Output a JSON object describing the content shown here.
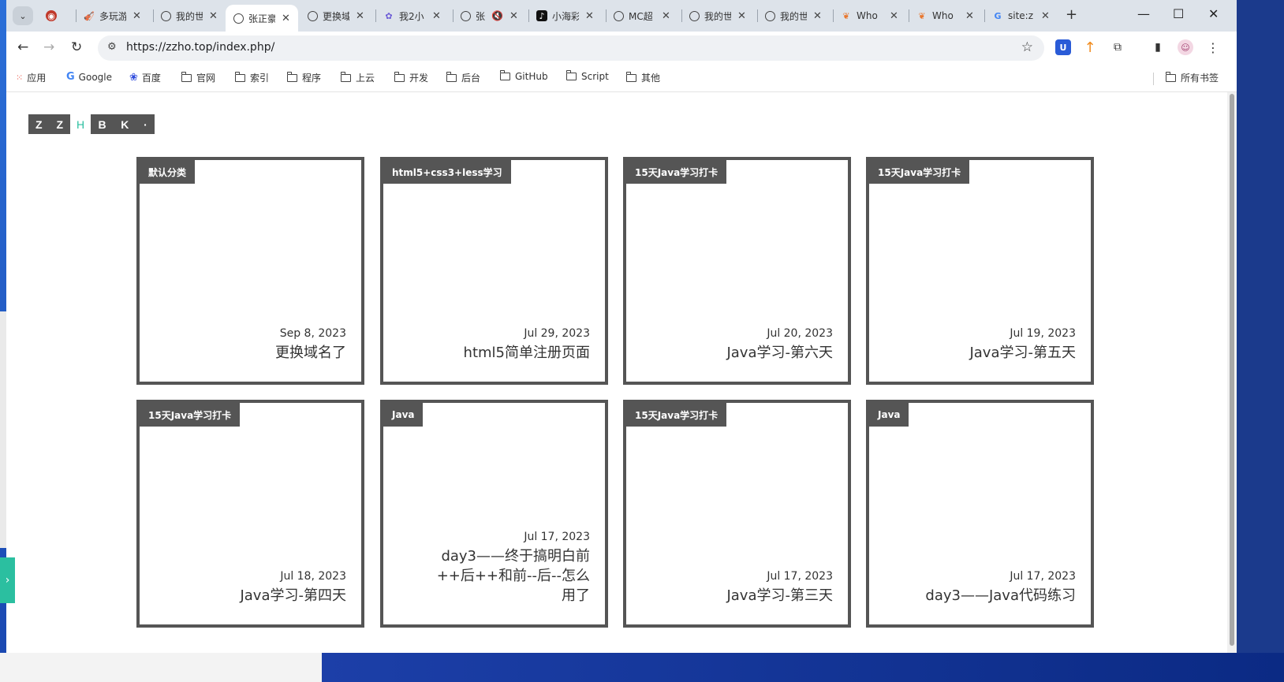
{
  "browser": {
    "tabs": [
      {
        "title": "",
        "icon": "eye-icon",
        "close": ""
      },
      {
        "title": "多玩游",
        "icon": "violin-icon",
        "close": "✕"
      },
      {
        "title": "我的世",
        "icon": "globe-icon",
        "close": "✕"
      },
      {
        "title": "张正豪",
        "icon": "globe-icon",
        "close": "✕",
        "active": true
      },
      {
        "title": "更换域",
        "icon": "globe-icon",
        "close": "✕"
      },
      {
        "title": "我2小",
        "icon": "anime-icon",
        "close": "✕"
      },
      {
        "title": "张",
        "icon": "globe-icon",
        "close": "✕",
        "muted": true
      },
      {
        "title": "小海彩",
        "icon": "tiktok-icon",
        "close": "✕"
      },
      {
        "title": "MC超",
        "icon": "globe-icon",
        "close": "✕"
      },
      {
        "title": "我的世",
        "icon": "globe-icon",
        "close": "✕"
      },
      {
        "title": "我的世",
        "icon": "globe-icon",
        "close": "✕"
      },
      {
        "title": "Who",
        "icon": "flame-icon",
        "close": "✕"
      },
      {
        "title": "Who",
        "icon": "flame-icon",
        "close": "✕"
      },
      {
        "title": "site:z",
        "icon": "google-icon",
        "close": "✕"
      }
    ],
    "new_tab": "+",
    "url": "https://zzho.top/index.php/",
    "bookmarks": [
      {
        "label": "应用",
        "type": "apps"
      },
      {
        "label": "Google",
        "type": "google"
      },
      {
        "label": "百度",
        "type": "baidu"
      },
      {
        "label": "官网",
        "type": "folder"
      },
      {
        "label": "索引",
        "type": "folder"
      },
      {
        "label": "程序",
        "type": "folder"
      },
      {
        "label": "上云",
        "type": "folder"
      },
      {
        "label": "开发",
        "type": "folder"
      },
      {
        "label": "后台",
        "type": "folder"
      },
      {
        "label": "GitHub",
        "type": "folder"
      },
      {
        "label": "Script",
        "type": "folder"
      },
      {
        "label": "其他",
        "type": "folder"
      }
    ],
    "all_bookmarks": "所有书签"
  },
  "site": {
    "logo": {
      "left": [
        "Z",
        "Z"
      ],
      "mid": "H",
      "right": [
        "B",
        "K",
        "·"
      ]
    },
    "posts": [
      {
        "category": "默认分类",
        "date": "Sep 8, 2023",
        "title": "更换域名了"
      },
      {
        "category": "html5+css3+less学习",
        "date": "Jul 29, 2023",
        "title": "html5简单注册页面"
      },
      {
        "category": "15天Java学习打卡",
        "date": "Jul 20, 2023",
        "title": "Java学习-第六天"
      },
      {
        "category": "15天Java学习打卡",
        "date": "Jul 19, 2023",
        "title": "Java学习-第五天"
      },
      {
        "category": "15天Java学习打卡",
        "date": "Jul 18, 2023",
        "title": "Java学习-第四天"
      },
      {
        "category": "Java",
        "date": "Jul 17, 2023",
        "title": "day3——终于搞明白前++后++和前--后--怎么用了"
      },
      {
        "category": "15天Java学习打卡",
        "date": "Jul 17, 2023",
        "title": "Java学习-第三天"
      },
      {
        "category": "Java",
        "date": "Jul 17, 2023",
        "title": "day3——Java代码练习"
      }
    ],
    "side_tab": "›"
  }
}
